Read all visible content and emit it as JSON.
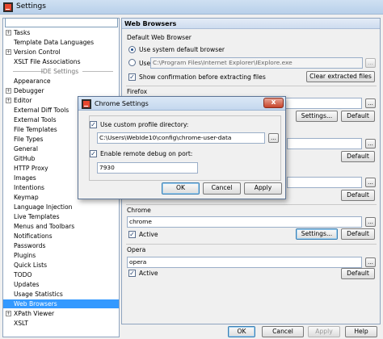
{
  "window": {
    "title": "Settings"
  },
  "search": {
    "value": ""
  },
  "tree": [
    {
      "label": "Tasks",
      "expander": "+",
      "indent": 1
    },
    {
      "label": "Template Data Languages",
      "expander": "",
      "indent": 1
    },
    {
      "label": "Version Control",
      "expander": "+",
      "indent": 1
    },
    {
      "label": "XSLT File Associations",
      "expander": "",
      "indent": 1
    },
    {
      "label": "IDE Settings",
      "separator": true
    },
    {
      "label": "Appearance",
      "expander": "",
      "indent": 1
    },
    {
      "label": "Debugger",
      "expander": "+",
      "indent": 1
    },
    {
      "label": "Editor",
      "expander": "+",
      "indent": 1
    },
    {
      "label": "External Diff Tools",
      "expander": "",
      "indent": 1
    },
    {
      "label": "External Tools",
      "expander": "",
      "indent": 1
    },
    {
      "label": "File Templates",
      "expander": "",
      "indent": 1
    },
    {
      "label": "File Types",
      "expander": "",
      "indent": 1
    },
    {
      "label": "General",
      "expander": "",
      "indent": 1
    },
    {
      "label": "GitHub",
      "expander": "",
      "indent": 1
    },
    {
      "label": "HTTP Proxy",
      "expander": "",
      "indent": 1
    },
    {
      "label": "Images",
      "expander": "",
      "indent": 1
    },
    {
      "label": "Intentions",
      "expander": "",
      "indent": 1
    },
    {
      "label": "Keymap",
      "expander": "",
      "indent": 1
    },
    {
      "label": "Language Injection",
      "expander": "",
      "indent": 1
    },
    {
      "label": "Live Templates",
      "expander": "",
      "indent": 1
    },
    {
      "label": "Menus and Toolbars",
      "expander": "",
      "indent": 1
    },
    {
      "label": "Notifications",
      "expander": "",
      "indent": 1
    },
    {
      "label": "Passwords",
      "expander": "",
      "indent": 1
    },
    {
      "label": "Plugins",
      "expander": "",
      "indent": 1
    },
    {
      "label": "Quick Lists",
      "expander": "",
      "indent": 1
    },
    {
      "label": "TODO",
      "expander": "",
      "indent": 1
    },
    {
      "label": "Updates",
      "expander": "",
      "indent": 1
    },
    {
      "label": "Usage Statistics",
      "expander": "",
      "indent": 1
    },
    {
      "label": "Web Browsers",
      "expander": "",
      "indent": 1,
      "selected": true
    },
    {
      "label": "XPath Viewer",
      "expander": "+",
      "indent": 1
    },
    {
      "label": "XSLT",
      "expander": "",
      "indent": 1
    }
  ],
  "main": {
    "header": "Web Browsers",
    "default_browser_label": "Default Web Browser",
    "use_system_default": "Use system default browser",
    "use_custom": "Use",
    "custom_path": "C:\\Program Files\\Internet Explorer\\IExplore.exe",
    "show_confirmation": "Show confirmation before extracting files",
    "clear_extracted": "Clear extracted files",
    "ellipsis": "...",
    "firefox": {
      "label": "Firefox",
      "settings": "Settings...",
      "default": "Default"
    },
    "chrome": {
      "label": "Chrome",
      "value": "chrome",
      "active": "Active",
      "settings": "Settings...",
      "default": "Default"
    },
    "opera": {
      "label": "Opera",
      "value": "opera",
      "active": "Active",
      "default": "Default"
    }
  },
  "dialog": {
    "title": "Chrome Settings",
    "close": "x",
    "use_custom_profile": "Use custom profile directory:",
    "profile_path": "C:\\Users\\WebIde10\\config\\chrome-user-data",
    "ellipsis": "...",
    "enable_remote_debug": "Enable remote debug on port:",
    "port": "7930",
    "ok": "OK",
    "cancel": "Cancel",
    "apply": "Apply"
  },
  "footer": {
    "ok": "OK",
    "cancel": "Cancel",
    "apply": "Apply",
    "help": "Help"
  },
  "colors": {
    "selection": "#3399ff",
    "titlebar": "#c4d7ee"
  }
}
